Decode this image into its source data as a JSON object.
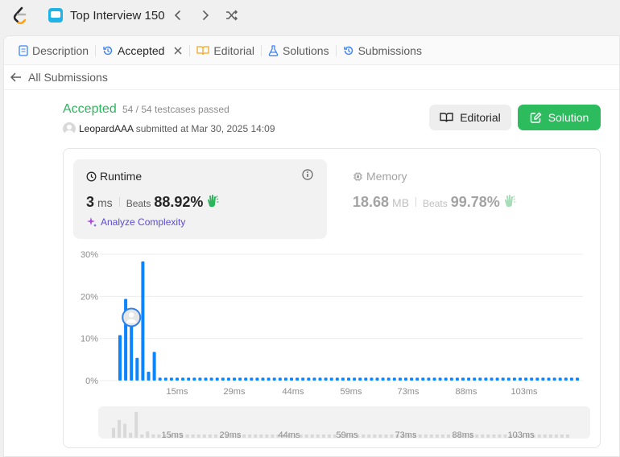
{
  "topbar": {
    "title": "Top Interview 150",
    "logo_icon": "leetcode-logo",
    "list_icon": "study-plan-icon"
  },
  "tabs": [
    {
      "label": "Description",
      "icon": "description-icon",
      "icon_color": "#3b82f6"
    },
    {
      "label": "Accepted",
      "icon": "history-icon",
      "icon_color": "#3b82f6",
      "active": true,
      "closable": true
    },
    {
      "label": "Editorial",
      "icon": "book-icon",
      "icon_color": "#f5a623"
    },
    {
      "label": "Solutions",
      "icon": "flask-icon",
      "icon_color": "#3b82f6"
    },
    {
      "label": "Submissions",
      "icon": "history-icon",
      "icon_color": "#3b82f6"
    }
  ],
  "subnav": {
    "back_label": "All Submissions"
  },
  "submission": {
    "status": "Accepted",
    "testcases": "54 / 54 testcases passed",
    "user": "LeopardAAA",
    "submitted_text": "submitted at Mar 30, 2025 14:09"
  },
  "buttons": {
    "editorial": "Editorial",
    "solution": "Solution"
  },
  "runtime": {
    "title": "Runtime",
    "value": "3",
    "unit": "ms",
    "beats_label": "Beats",
    "beats_pct": "88.92%",
    "analyze_label": "Analyze Complexity"
  },
  "memory": {
    "title": "Memory",
    "value": "18.68",
    "unit": "MB",
    "beats_label": "Beats",
    "beats_pct": "99.78%"
  },
  "colors": {
    "accepted": "#2db55d",
    "solution_button": "#2cbb5d",
    "bar": "#0a84ff",
    "analyze": "#5d4bd1"
  },
  "chart_data": {
    "type": "bar",
    "ylim": [
      0,
      30
    ],
    "yticks": [
      "30%",
      "20%",
      "10%",
      "0%"
    ],
    "xticks": [
      "15ms",
      "29ms",
      "44ms",
      "59ms",
      "73ms",
      "88ms",
      "103ms"
    ],
    "highlight_index": 2,
    "values": [
      10.8,
      19.4,
      15.2,
      5.4,
      28.3,
      2.1,
      6.8,
      0.7,
      0.7,
      0.7,
      0.7,
      0.7,
      0.7,
      0.7,
      0.7,
      0.7,
      0.7,
      0.7,
      0.7,
      0.7,
      0.7,
      0.7,
      0.7,
      0.7,
      0.7,
      0.7,
      0.7,
      0.7,
      0.7,
      0.7,
      0.7,
      0.7,
      0.7,
      0.7,
      0.7,
      0.7,
      0.7,
      0.7,
      0.7,
      0.7,
      0.7,
      0.7,
      0.7,
      0.7,
      0.7,
      0.7,
      0.7,
      0.7,
      0.7,
      0.7,
      0.7,
      0.7,
      0.7,
      0.7,
      0.7,
      0.7,
      0.7,
      0.7,
      0.7,
      0.7,
      0.7,
      0.7,
      0.7,
      0.7,
      0.7,
      0.7,
      0.7,
      0.7,
      0.7,
      0.7,
      0.7,
      0.7,
      0.7,
      0.7,
      0.7,
      0.7,
      0.7,
      0.7,
      0.7,
      0.7,
      0.7
    ]
  }
}
